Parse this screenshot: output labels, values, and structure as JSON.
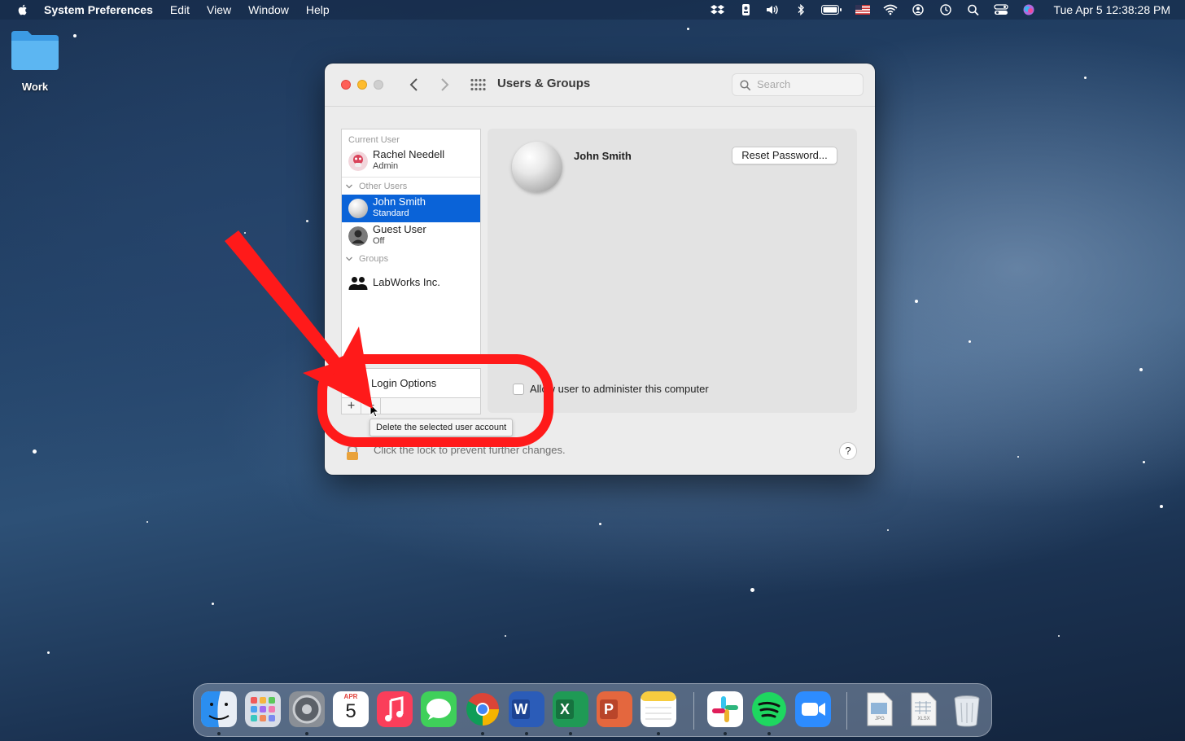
{
  "menubar": {
    "app_name": "System Preferences",
    "items": [
      "Edit",
      "View",
      "Window",
      "Help"
    ],
    "clock": "Tue Apr 5  12:38:28 PM"
  },
  "desktop": {
    "folder_label": "Work"
  },
  "window": {
    "title": "Users & Groups",
    "search_placeholder": "Search",
    "sidebar": {
      "current_user_header": "Current User",
      "current_user": {
        "name": "Rachel Needell",
        "role": "Admin"
      },
      "other_users_header": "Other Users",
      "other_users": [
        {
          "name": "John Smith",
          "role": "Standard",
          "selected": true
        },
        {
          "name": "Guest User",
          "role": "Off",
          "selected": false
        }
      ],
      "groups_header": "Groups",
      "groups": [
        {
          "name": "LabWorks Inc."
        }
      ],
      "login_options": "Login Options",
      "add_symbol": "+",
      "remove_symbol": "−"
    },
    "detail": {
      "user_name": "John Smith",
      "reset_password_label": "Reset Password...",
      "allow_admin_label": "Allow user to administer this computer",
      "allow_admin_checked": false
    },
    "tooltip": "Delete the selected user account",
    "lock_text": "Click the lock to prevent further changes.",
    "help_label": "?"
  },
  "dock": {
    "calendar_month": "APR",
    "calendar_day": "5",
    "word_letter": "W",
    "excel_letter": "X",
    "powerpoint_letter": "P",
    "jpg_label": "JPG",
    "xlsx_label": "XLSX"
  },
  "colors": {
    "selection": "#0a63d8",
    "annotation_red": "#ff1a1a",
    "close": "#fe5f57",
    "minimize": "#febc2e"
  }
}
